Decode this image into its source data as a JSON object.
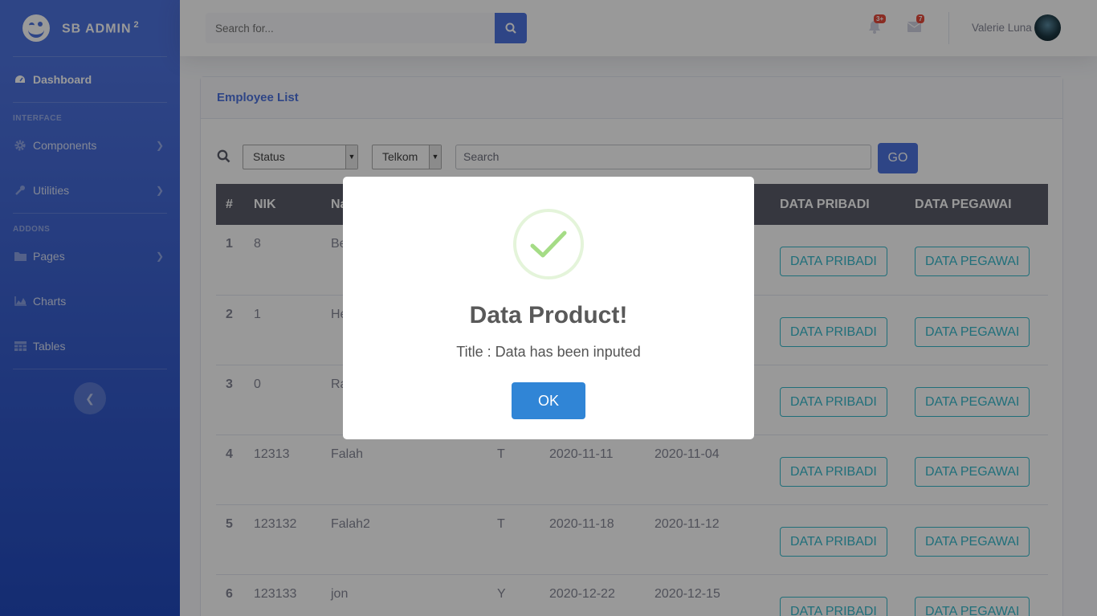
{
  "sidebar": {
    "brand": "SB ADMIN",
    "brand_sup": "2",
    "dashboard": "Dashboard",
    "heading_interface": "INTERFACE",
    "components": "Components",
    "utilities": "Utilities",
    "heading_addons": "ADDONS",
    "pages": "Pages",
    "charts": "Charts",
    "tables": "Tables"
  },
  "topbar": {
    "search_placeholder": "Search for...",
    "alerts_badge": "3+",
    "messages_badge": "7",
    "username": "Valerie Luna"
  },
  "card": {
    "title": "Employee List",
    "filter_status": "Status",
    "filter_company": "Telkom",
    "search_placeholder": "Search",
    "go": "GO"
  },
  "table": {
    "headers": [
      "#",
      "NIK",
      "Na",
      "",
      "",
      "",
      "DATA PRIBADI",
      "DATA PEGAWAI"
    ],
    "rows": [
      {
        "no": "1",
        "nik": "8",
        "name": "Be",
        "g": "",
        "d1": "",
        "d2": ""
      },
      {
        "no": "2",
        "nik": "1",
        "name": "He",
        "g": "",
        "d1": "",
        "d2": ""
      },
      {
        "no": "3",
        "nik": "0",
        "name": "Ra",
        "g": "",
        "d1": "",
        "d2": ""
      },
      {
        "no": "4",
        "nik": "12313",
        "name": "Falah",
        "g": "T",
        "d1": "2020-11-11",
        "d2": "2020-11-04"
      },
      {
        "no": "5",
        "nik": "123132",
        "name": "Falah2",
        "g": "T",
        "d1": "2020-11-18",
        "d2": "2020-11-12"
      },
      {
        "no": "6",
        "nik": "123133",
        "name": "jon",
        "g": "Y",
        "d1": "2020-12-22",
        "d2": "2020-12-15"
      }
    ],
    "btn_pribadi": "DATA PRIBADI",
    "btn_pegawai": "DATA PEGAWAI"
  },
  "modal": {
    "title": "Data Product!",
    "text": "Title : Data has been inputed",
    "ok": "OK"
  },
  "colors": {
    "primary": "#4e73df",
    "info": "#36b9cc",
    "success": "#a5dc86",
    "confirm": "#3085d6"
  }
}
